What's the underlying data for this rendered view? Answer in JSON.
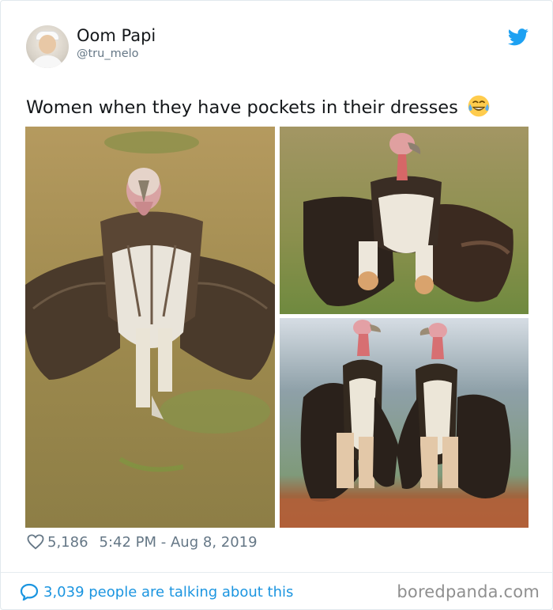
{
  "author": {
    "display_name": "Oom Papi",
    "handle": "@tru_melo",
    "avatar_icon": "profile-photo"
  },
  "tweet": {
    "text": "Women when they have pockets in their dresses",
    "emoji": "face-with-tears-of-joy",
    "images": [
      {
        "name": "vulture-spread-wings-photo"
      },
      {
        "name": "vulture-wings-open-photo"
      },
      {
        "name": "two-vultures-photo"
      }
    ]
  },
  "meta": {
    "likes": "5,186",
    "timestamp": "5:42 PM - Aug 8, 2019"
  },
  "footer": {
    "talking_text": "3,039 people are talking about this",
    "watermark": "boredpanda.com"
  },
  "colors": {
    "twitter_blue": "#1da1f2",
    "link_blue": "#1b95e0",
    "muted_gray": "#657786"
  }
}
